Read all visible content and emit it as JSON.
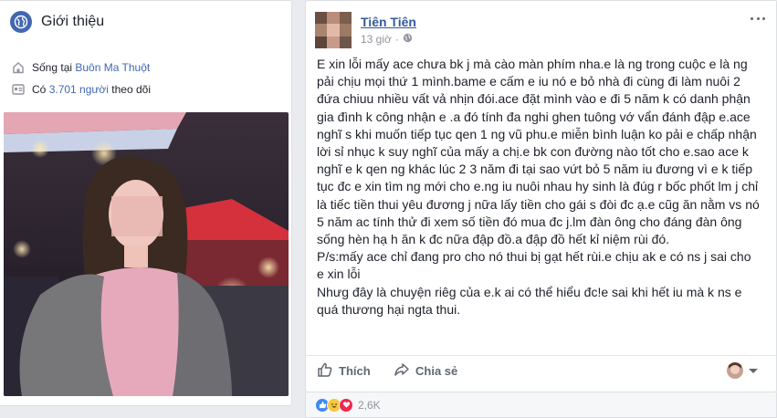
{
  "intro": {
    "title": "Giới thiệu",
    "lives_prefix": "Sống tại ",
    "lives_city": "Buôn Ma Thuột",
    "followers_prefix": "Có ",
    "followers_count": "3.701 người",
    "followers_suffix": " theo dõi"
  },
  "post": {
    "author": "Tiên Tiên",
    "time": "13 giờ",
    "meta_dot": "·",
    "paragraphs": [
      "E xin lỗi mấy ace chưa bk j mà cào màn phím nha.e là ng trong cuộc e là ng pải chịu mọi thứ 1 mình.bame e cấm e iu nó e bỏ nhà đi cùng đi làm nuôi 2 đứa chiuu nhiều vất vả nhịn đói.ace đặt mình vào e đi 5 năm k có danh phận gia đình k công nhận e .a đó tính đa nghi ghen tuông vớ vẩn đánh đập e.ace nghĩ s khi muốn tiếp tục qen 1 ng vũ phu.e miễn bình luận ko pải e chấp nhận lời sỉ nhục k suy nghĩ của mấy a chị.e bk con đường nào tốt cho e.sao ace k nghĩ e k qen ng khác lúc 2 3 năm đi tại sao vứt bỏ 5 năm iu đương vì e k tiếp tục đc e xin tìm ng mới cho e.ng iu nuôi nhau hy sinh là đúg r bốc phốt lm j chỉ là tiếc tiền thui yêu đương j nữa lấy tiền cho gái s đòi đc ạ.e cũg ăn nằm vs nó 5 năm ac tính thử đi xem số tiền đó mua đc j.lm đàn ông cho đáng đàn ông sống hèn hạ                              h ăn k đc nữa đập đồ.a đập đồ hết kỉ niệm rùi đó.",
      "P/s:mấy ace chỉ đang pro cho nó thui bị gạt hết rùi.e chịu ak e có ns j sai cho e xin lỗi",
      "Nhưg đây là chuyện riêg của e.k ai có thể hiểu đc!e sai khi hết iu mà k ns e quá thương hại ngta thui."
    ],
    "like_label": "Thích",
    "share_label": "Chia sẻ",
    "reaction_count": "2,6K"
  },
  "colors": {
    "page_bg": "#e9ebee",
    "link_blue": "#365899",
    "brand_blue": "#4267b2",
    "secondary_text": "#90949c",
    "like_blue": "#3b8af4",
    "haha_yellow": "#f7c741",
    "love_red": "#f0284a"
  },
  "icons": {
    "intro": "globe-icon",
    "lives": "home-icon",
    "followers": "followers-icon",
    "privacy": "public-globe-icon",
    "more": "more-options-icon",
    "like": "thumbs-up-icon",
    "share": "share-arrow-icon",
    "reactions": [
      "like-reaction-icon",
      "haha-reaction-icon",
      "love-reaction-icon"
    ]
  }
}
